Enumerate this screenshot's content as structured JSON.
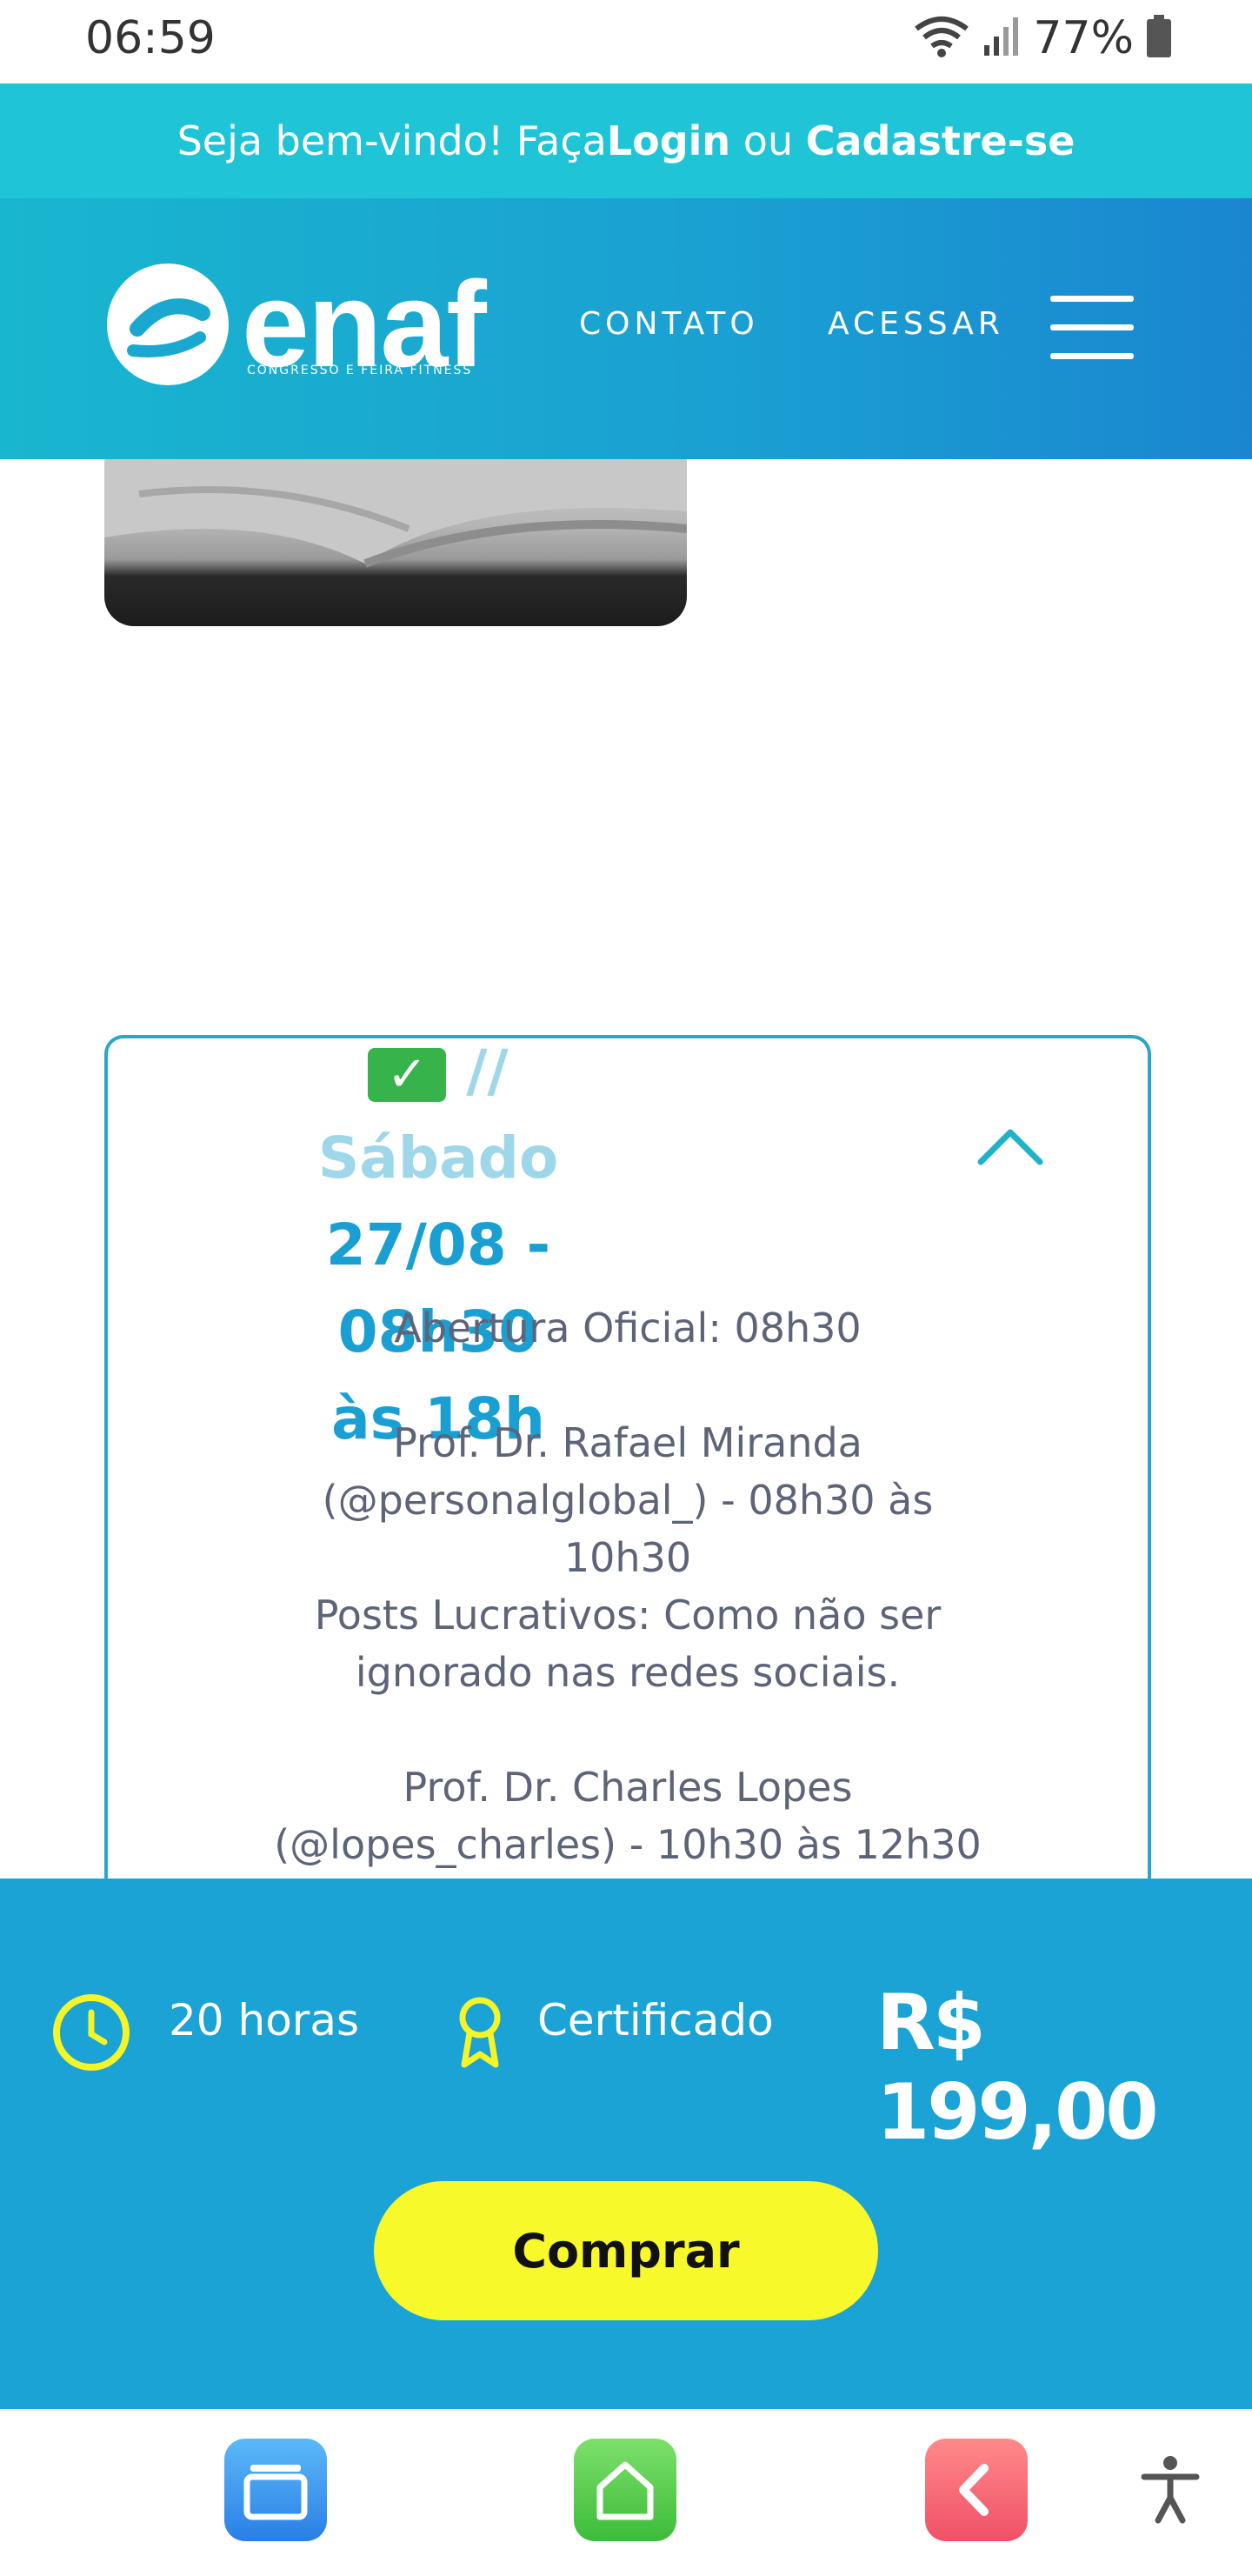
{
  "status_bar": {
    "time": "06:59",
    "battery": "77%",
    "icons": [
      "wifi-icon",
      "signal-icon",
      "battery-icon"
    ]
  },
  "welcome": {
    "prefix": "Seja bem-vindo! Faça ",
    "login": "Login",
    "middle": " ou ",
    "signup": "Cadastre-se"
  },
  "header": {
    "logo_text": "enaf",
    "logo_subtitle": "CONGRESSO E FEIRA FITNESS",
    "nav": {
      "contato": "CONTATO",
      "acessar": "ACESSAR"
    }
  },
  "card": {
    "title_line1": " // Sábado",
    "title_line2": "27/08 - 08h30",
    "title_line3": "às 18h",
    "body": {
      "abertura": "Abertura Oficial: 08h30",
      "speaker1_line1": "Prof. Dr. Rafael Miranda",
      "speaker1_line2": "(@personalglobal_) - 08h30 às",
      "speaker1_line3": "10h30",
      "topic1_line1": "Posts Lucrativos: Como não ser",
      "topic1_line2": "ignorado nas redes sociais.",
      "speaker2_line1": "Prof. Dr. Charles Lopes",
      "speaker2_line2": "(@lopes_charles) - 10h30 às 12h30"
    }
  },
  "buy": {
    "hours": "20 horas",
    "certificate": "Certificado",
    "price": "R$ 199,00",
    "button": "Comprar"
  },
  "colors": {
    "accent": "#1aa3d4",
    "welcome_bg": "#1fc4d6",
    "button": "#f7f92a",
    "icon_yellow": "#f4f42a"
  }
}
